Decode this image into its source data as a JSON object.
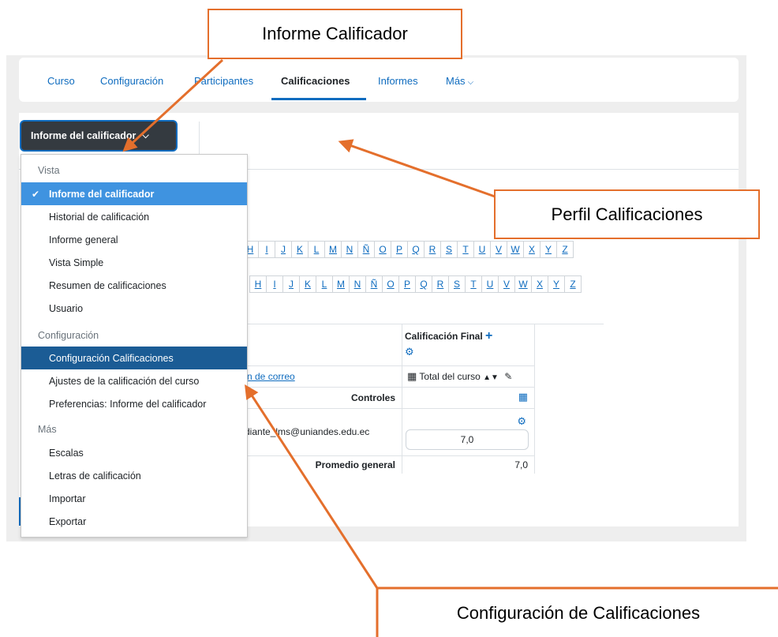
{
  "nav": {
    "items": [
      {
        "label": "Curso"
      },
      {
        "label": "Configuración"
      },
      {
        "label": "Participantes"
      },
      {
        "label": "Calificaciones"
      },
      {
        "label": "Informes"
      },
      {
        "label": "Más"
      }
    ],
    "active": "Calificaciones"
  },
  "report_selector": {
    "label": "Informe del calificador"
  },
  "filters": {
    "row1": [
      "H",
      "I",
      "J",
      "K",
      "L",
      "M",
      "N",
      "Ñ",
      "O",
      "P",
      "Q",
      "R",
      "S",
      "T",
      "U",
      "V",
      "W",
      "X",
      "Y",
      "Z"
    ],
    "row2": [
      "H",
      "I",
      "J",
      "K",
      "L",
      "M",
      "N",
      "Ñ",
      "O",
      "P",
      "Q",
      "R",
      "S",
      "T",
      "U",
      "V",
      "W",
      "X",
      "Y",
      "Z"
    ]
  },
  "table": {
    "final_header": "Calificación Final",
    "email_link": "n de correo",
    "course_total": "Total del curso",
    "controls_label": "Controles",
    "student_email": "tudiante_lms@uniandes.edu.ec",
    "student_grade": "7,0",
    "average_label": "Promedio general",
    "average_value": "7,0"
  },
  "menu": {
    "sections": [
      {
        "heading": "Vista",
        "items": [
          {
            "label": "Informe del calificador",
            "selected": true
          },
          {
            "label": "Historial de calificación"
          },
          {
            "label": "Informe general"
          },
          {
            "label": "Vista Simple"
          },
          {
            "label": "Resumen de calificaciones"
          },
          {
            "label": "Usuario"
          }
        ]
      },
      {
        "heading": "Configuración",
        "items": [
          {
            "label": "Configuración Calificaciones",
            "highlighted": true
          },
          {
            "label": "Ajustes de la calificación del curso"
          },
          {
            "label": "Preferencias: Informe del calificador"
          }
        ]
      },
      {
        "heading": "Más",
        "items": [
          {
            "label": "Escalas"
          },
          {
            "label": "Letras de calificación"
          },
          {
            "label": "Importar"
          },
          {
            "label": "Exportar"
          }
        ]
      }
    ]
  },
  "annotations": {
    "grader_report": "Informe Calificador",
    "grades_profile": "Perfil Calificaciones",
    "grades_config": "Configuración de Calificaciones"
  },
  "colors": {
    "annotation": "#e46f2c",
    "link": "#0f6cbf",
    "menu_selected": "#3f93e0",
    "menu_highlight": "#1b5c95",
    "button_dark": "#343a40"
  },
  "icons": {
    "check": "check-icon",
    "plus": "plus-icon",
    "gear": "gear-icon",
    "calculator": "calculator-icon",
    "sort": "sort-icon",
    "pencil": "pencil-icon",
    "chevron": "chevron-down-icon"
  }
}
